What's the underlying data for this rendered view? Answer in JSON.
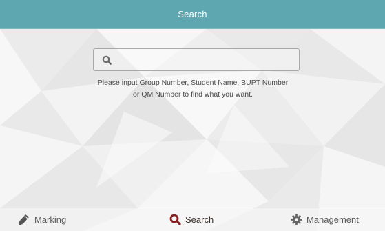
{
  "header": {
    "title": "Search"
  },
  "search": {
    "value": "",
    "placeholder": "",
    "icon": "search-icon"
  },
  "hint": {
    "line1": "Please input Group Number, Student Name,  BUPT Number",
    "line2": "or QM Number to find what you want."
  },
  "tabs": [
    {
      "label": "Marking",
      "icon": "pencil-icon",
      "active": false
    },
    {
      "label": "Search",
      "icon": "search-icon",
      "active": true
    },
    {
      "label": "Management",
      "icon": "gear-icon",
      "active": false
    }
  ],
  "colors": {
    "header_bg": "#5fa7b0",
    "active_tab": "#8a1c1c",
    "inactive_tab": "#5a5a5a"
  }
}
